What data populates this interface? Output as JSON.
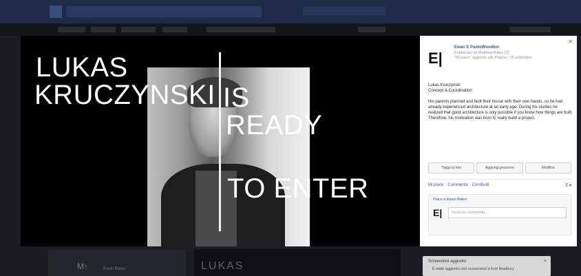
{
  "header": {
    "window_title": "",
    "search_placeholder": ""
  },
  "post": {
    "headline_line1": "LUKAS",
    "headline_line2": "KRUCZYNSKI",
    "headline_line3": "IS",
    "headline_line4": "READY",
    "headline_line5": "TO ENTER"
  },
  "side_panel": {
    "close": "×",
    "page_avatar": "E|",
    "page_name": "Ewan E PantoWoodkin",
    "meta_line1": "Pubblicato da Matthew Bates [?]",
    "meta_line2": "\"Mi piace\" aggiunto alla Pagina · 25 settembre",
    "meta_line3": "·",
    "caption_line1": "Lukas Kruczynski",
    "caption_line2": "Concept & Coordination",
    "caption_body": "His parents planned and built their house with their own hands, so he had already experienced architecture at an early age. During his studies he realized that good architecture is only possible if you know how things are built. Therefore, his motivation was born to really build a project.",
    "actions": [
      "Tagga la foto",
      "Aggiungi posizione",
      "Modifica"
    ],
    "reactions": [
      "Mi piace",
      "Commenta",
      "Condividi"
    ],
    "reaction_menu": "E ▾",
    "like_text": "Piace a Ewan Bates",
    "comment_avatar": "E|",
    "comment_placeholder": "Scrivi un commento..."
  },
  "bottom": {
    "icon": "M↑",
    "name": "Ewan Bates",
    "lukas": "LUKAS"
  },
  "toast": {
    "title": "Screenshot aggiunto",
    "body": "È stato aggiunto uno screenshot a Kurt Bradbury",
    "close": "× "
  }
}
